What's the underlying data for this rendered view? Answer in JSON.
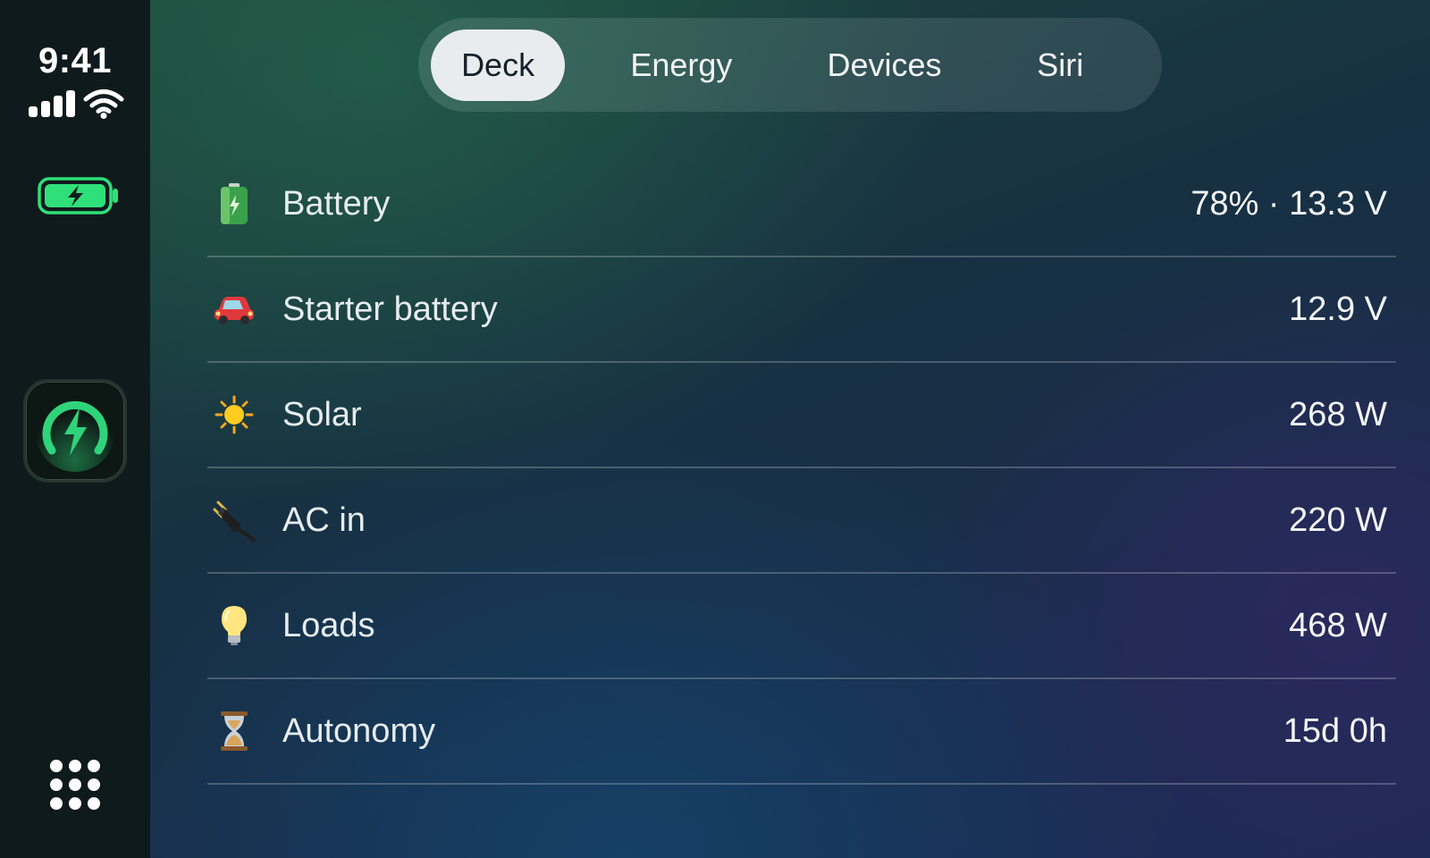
{
  "status": {
    "time": "9:41",
    "signal_icon": "cellular-signal-icon",
    "wifi_icon": "wifi-icon",
    "battery_icon": "battery-charging-icon",
    "battery_color": "#2fe07a"
  },
  "sidebar": {
    "app_icon": "power-gauge-app-icon",
    "app_accent": "#2fd47a",
    "launcher_icon": "app-grid-icon"
  },
  "tabs": [
    {
      "label": "Deck",
      "active": true
    },
    {
      "label": "Energy",
      "active": false
    },
    {
      "label": "Devices",
      "active": false
    },
    {
      "label": "Siri",
      "active": false
    }
  ],
  "rows": [
    {
      "icon": "battery-icon",
      "label": "Battery",
      "value": "78% · 13.3 V"
    },
    {
      "icon": "car-icon",
      "label": "Starter battery",
      "value": "12.9 V"
    },
    {
      "icon": "sun-icon",
      "label": "Solar",
      "value": "268 W"
    },
    {
      "icon": "plug-icon",
      "label": "AC in",
      "value": "220 W"
    },
    {
      "icon": "lightbulb-icon",
      "label": "Loads",
      "value": "468 W"
    },
    {
      "icon": "hourglass-icon",
      "label": "Autonomy",
      "value": "15d 0h"
    }
  ]
}
